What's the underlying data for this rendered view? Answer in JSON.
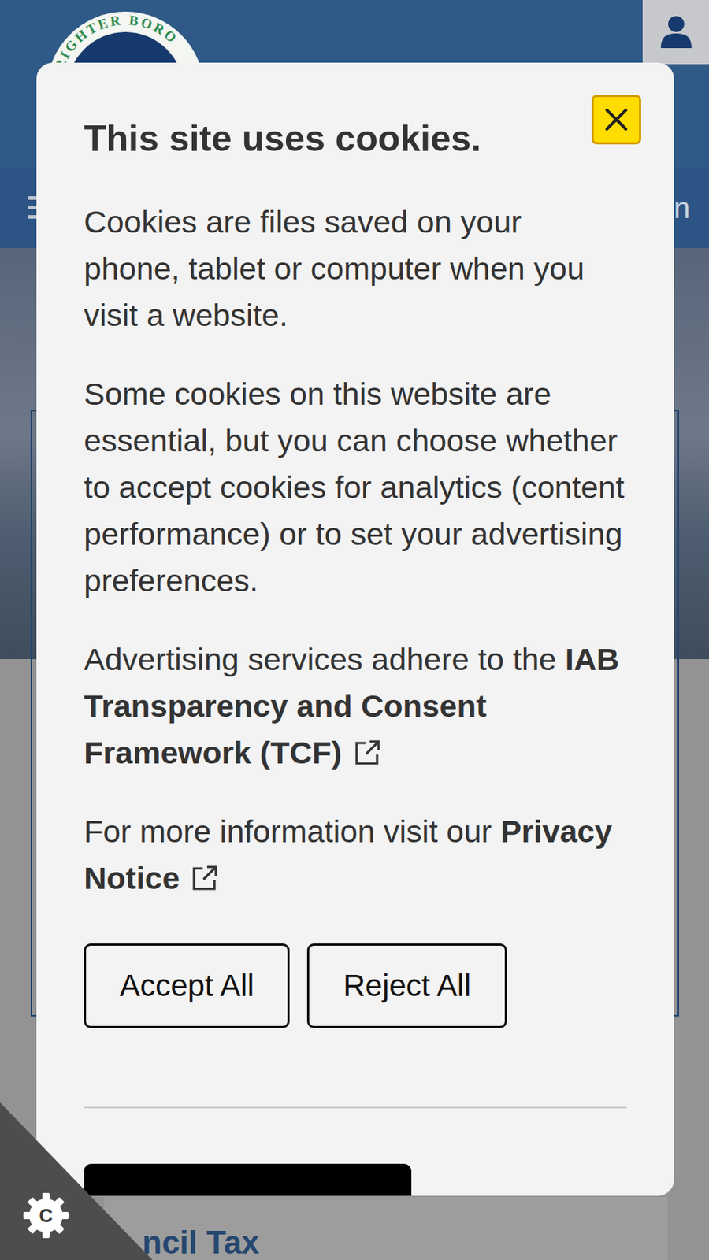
{
  "header": {
    "logo_text": "BRIGHTER BORO",
    "nav_fragment": "n"
  },
  "cookie_dialog": {
    "title": "This site uses cookies.",
    "intro_paragraphs": [
      [
        "Cookies are files saved on your",
        "phone, tablet or computer when you",
        "visit a website."
      ],
      [
        "Some cookies on this website are",
        "essential, but you can choose whether",
        "to accept cookies for analytics (content",
        "performance) or to set your advertising",
        "preferences."
      ]
    ],
    "tcf_notice": {
      "text": "Advertising services adhere to the ",
      "link": "IAB Transparency and Consent Framework (TCF)"
    },
    "privacy_notice": {
      "text": "For more information visit our ",
      "link": "Privacy Notice"
    },
    "buttons": [
      "Accept All",
      "Reject All"
    ]
  },
  "page": {
    "section_title": "ncil Tax"
  },
  "consent_badge": {
    "label": "C"
  }
}
